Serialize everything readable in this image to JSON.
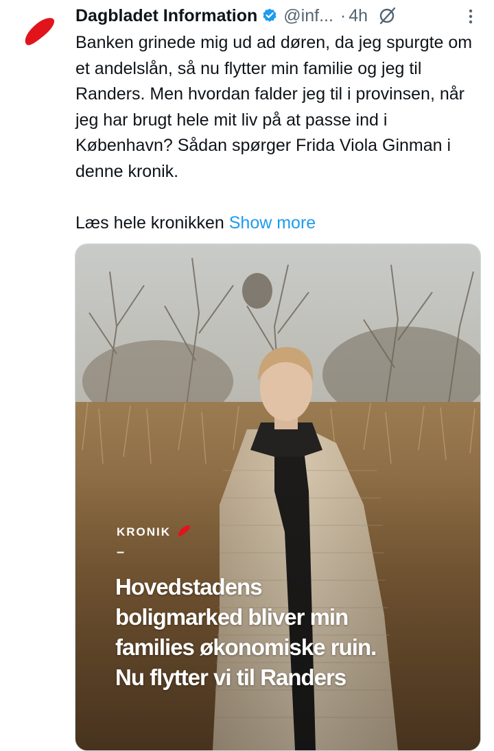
{
  "tweet": {
    "author_name": "Dagbladet Information",
    "handle": "@inf...",
    "separator": "·",
    "time": "4h",
    "text_paragraph_1": "Banken grinede mig ud ad døren, da jeg spurgte om et andelslån, så nu flytter min familie og jeg til Randers. Men hvordan falder jeg til i provinsen, når jeg har brugt hele mit liv på at passe ind i København? Sådan spørger Frida Viola Ginman i denne kronik.",
    "text_paragraph_2": "Læs hele kronikken",
    "show_more": "Show more",
    "icons": {
      "avatar": "information-logo-red-mark",
      "verified": "verified-badge-icon",
      "grok": "grok-icon",
      "more": "more-options-icon"
    }
  },
  "media": {
    "section_label": "KRONIK",
    "dash": "–",
    "headline_lines": [
      "Hovedstadens",
      "boligmarked bliver min",
      "families økonomiske ruin.",
      "Nu flytter vi til Randers"
    ]
  },
  "colors": {
    "accent_red": "#e1141c",
    "link_blue": "#1d9bf0",
    "verified_blue": "#1d9bf0",
    "muted_text": "#536471"
  }
}
